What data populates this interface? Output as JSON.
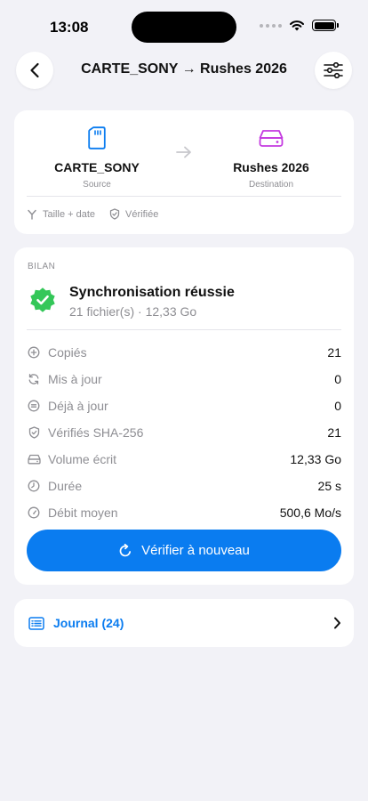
{
  "status_bar": {
    "time": "13:08"
  },
  "header": {
    "title": "CARTE_SONY → Rushes 2026"
  },
  "route": {
    "source": {
      "name": "CARTE_SONY",
      "role": "Source"
    },
    "destination": {
      "name": "Rushes 2026",
      "role": "Destination"
    },
    "compare_mode": "Taille + date",
    "verify_mode": "Vérifiée"
  },
  "summary": {
    "section_label": "BILAN",
    "title": "Synchronisation réussie",
    "subtitle": "21 fichier(s) · 12,33 Go",
    "stats": [
      {
        "icon": "plus-circle-icon",
        "label": "Copiés",
        "value": "21"
      },
      {
        "icon": "sync-icon",
        "label": "Mis à jour",
        "value": "0"
      },
      {
        "icon": "equal-circle-icon",
        "label": "Déjà à jour",
        "value": "0"
      },
      {
        "icon": "shield-check-icon",
        "label": "Vérifiés SHA-256",
        "value": "21"
      },
      {
        "icon": "drive-icon",
        "label": "Volume écrit",
        "value": "12,33 Go"
      },
      {
        "icon": "clock-icon",
        "label": "Durée",
        "value": "25 s"
      },
      {
        "icon": "gauge-icon",
        "label": "Débit moyen",
        "value": "500,6 Mo/s"
      }
    ],
    "verify_button": "Vérifier à nouveau"
  },
  "journal": {
    "label": "Journal (24)"
  },
  "colors": {
    "accent": "#0a7cf0",
    "success": "#34c759",
    "destination": "#c43ae0",
    "background": "#f2f2f7"
  }
}
